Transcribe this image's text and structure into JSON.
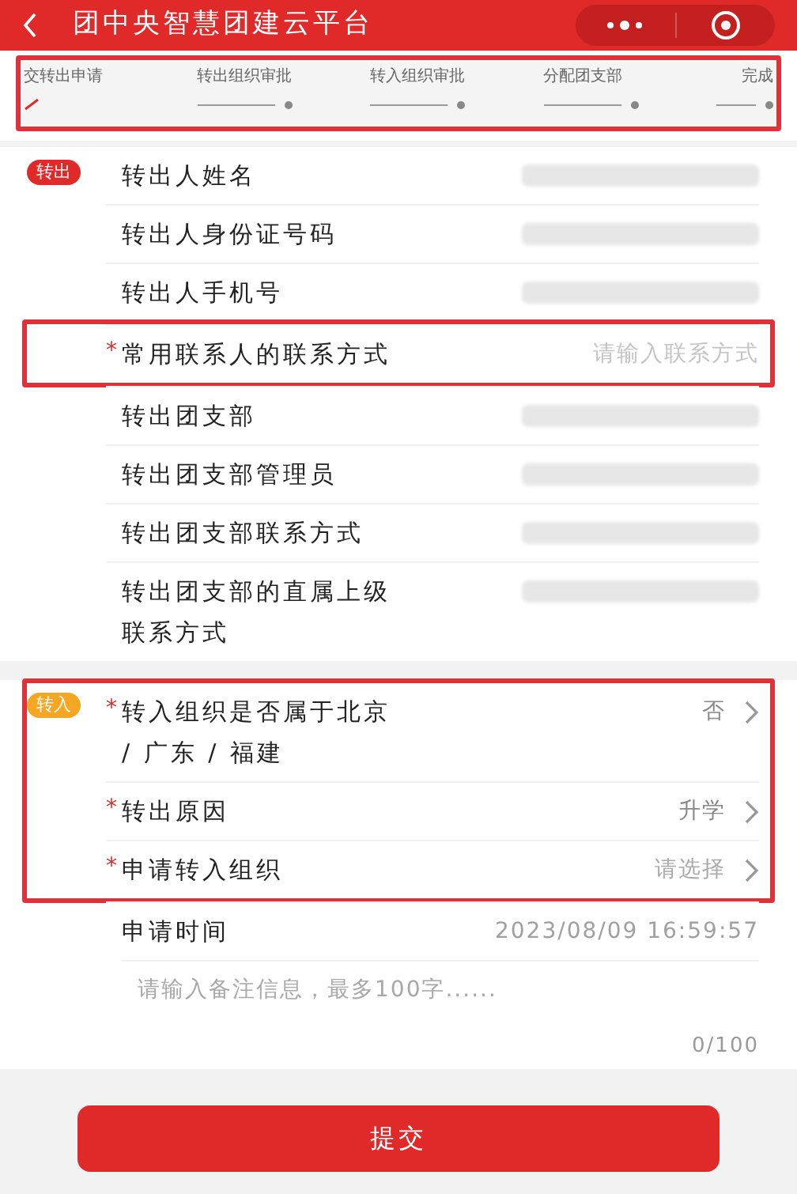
{
  "header": {
    "title": "团中央智慧团建云平台"
  },
  "steps": [
    {
      "label": "交转出申请",
      "done": true
    },
    {
      "label": "转出组织审批",
      "done": false
    },
    {
      "label": "转入组织审批",
      "done": false
    },
    {
      "label": "分配团支部",
      "done": false
    },
    {
      "label": "完成",
      "done": false
    }
  ],
  "sections": [
    {
      "tag": {
        "text": "转出",
        "color": "#e02a2a"
      },
      "rows": [
        {
          "kind": "redacted",
          "label": "转出人姓名",
          "required": false,
          "highlighted": false
        },
        {
          "kind": "redacted",
          "label": "转出人身份证号码",
          "required": false,
          "highlighted": false
        },
        {
          "kind": "redacted",
          "label": "转出人手机号",
          "required": false,
          "highlighted": false
        },
        {
          "kind": "input",
          "label": "常用联系人的联系方式",
          "required": true,
          "placeholder": "请输入联系方式",
          "highlighted": true
        },
        {
          "kind": "redacted",
          "label": "转出团支部",
          "required": false,
          "highlighted": false
        },
        {
          "kind": "redacted",
          "label": "转出团支部管理员",
          "required": false,
          "highlighted": false
        },
        {
          "kind": "redacted",
          "label": "转出团支部联系方式",
          "required": false,
          "highlighted": false
        },
        {
          "kind": "redacted",
          "label": "转出团支部的直属上级联系方式",
          "required": false,
          "highlighted": false
        }
      ]
    },
    {
      "tag": {
        "text": "转入",
        "color": "#f5a623"
      },
      "rows": [
        {
          "kind": "select",
          "label": "转入组织是否属于北京 / 广东 / 福建",
          "required": true,
          "value": "否",
          "highlighted": true
        },
        {
          "kind": "select",
          "label": "转出原因",
          "required": true,
          "value": "升学",
          "highlighted": true
        },
        {
          "kind": "select",
          "label": "申请转入组织",
          "required": true,
          "placeholder": "请选择",
          "highlighted": true
        },
        {
          "kind": "value",
          "label": "申请时间",
          "required": false,
          "value": "2023/08/09 16:59:57",
          "highlighted": false
        },
        {
          "kind": "textarea",
          "placeholder": "请输入备注信息，最多100字......",
          "counter": "0/100",
          "highlighted": false
        }
      ]
    }
  ],
  "required_mark": "*",
  "submit": "提交"
}
